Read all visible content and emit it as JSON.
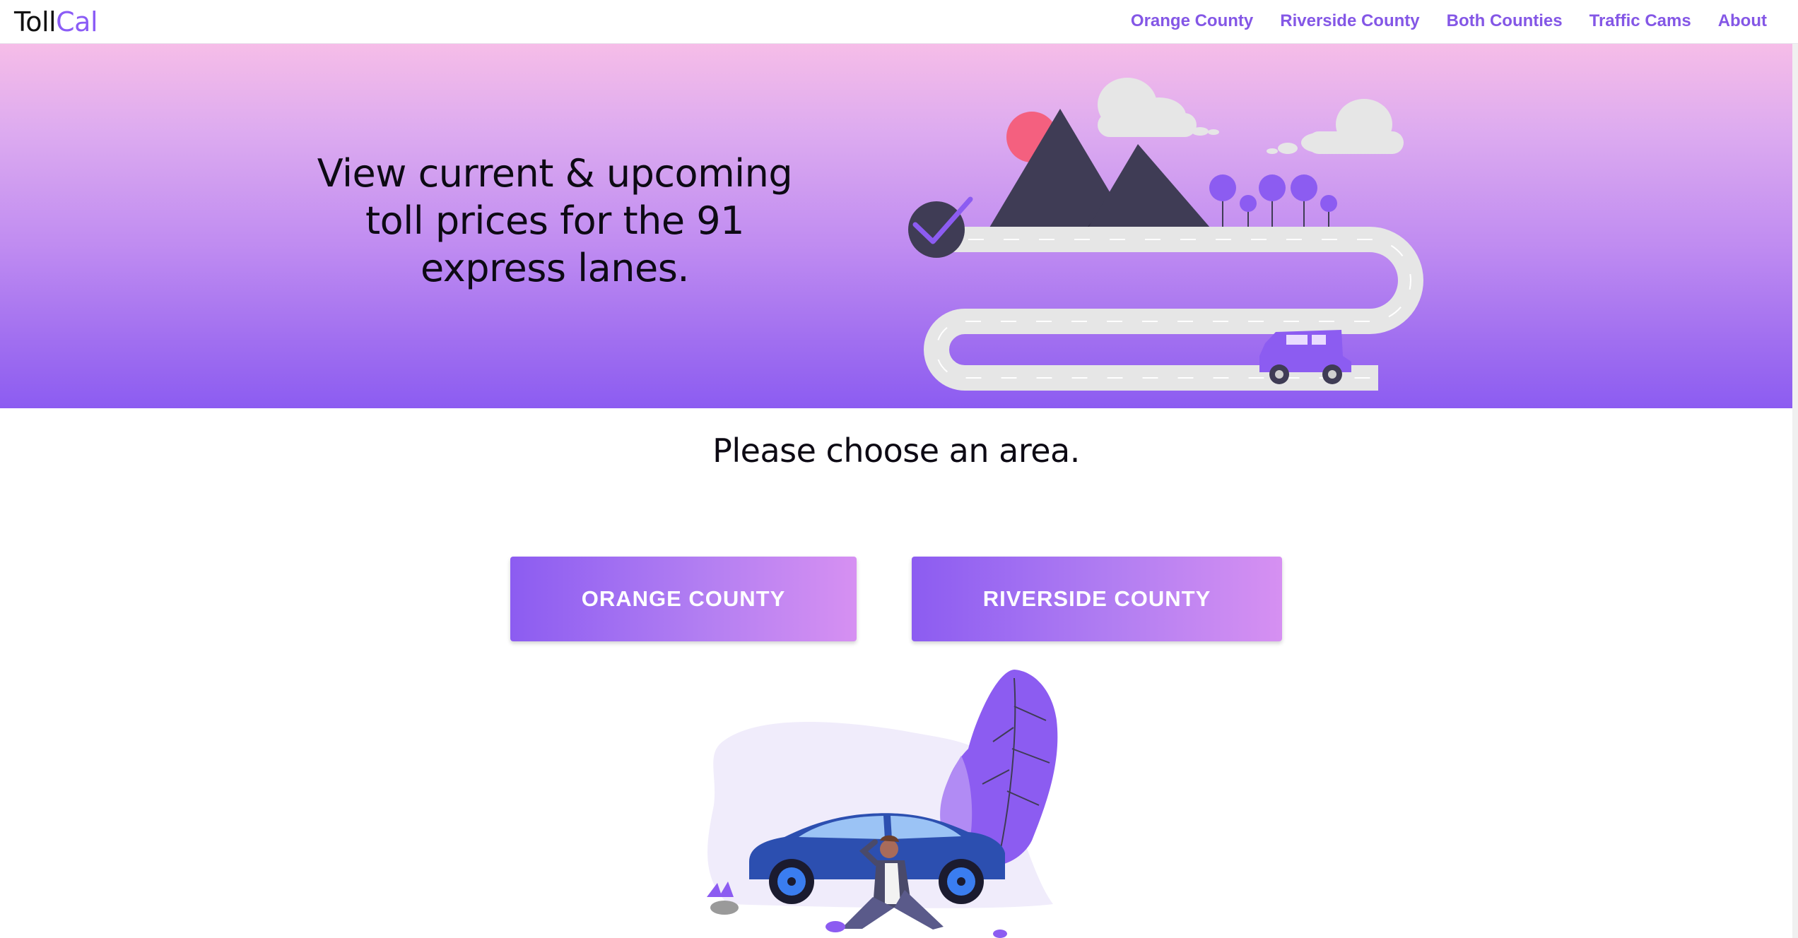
{
  "brand": {
    "part1": "Toll",
    "part2": "Cal"
  },
  "nav": {
    "items": [
      {
        "label": "Orange County"
      },
      {
        "label": "Riverside County"
      },
      {
        "label": "Both Counties"
      },
      {
        "label": "Traffic Cams"
      },
      {
        "label": "About"
      }
    ]
  },
  "hero": {
    "line1": "View current & upcoming",
    "line2": "toll prices for the 91",
    "line3": "express lanes."
  },
  "main": {
    "heading": "Please choose an area.",
    "buttons": [
      {
        "label": "ORANGE COUNTY"
      },
      {
        "label": "RIVERSIDE COUNTY"
      }
    ]
  },
  "colors": {
    "accent": "#8b5cf6",
    "nav_link": "#8457e6",
    "hero_top": "#f6bde8",
    "hero_bottom": "#8c5cf1",
    "button_start": "#8c5cf1",
    "button_end": "#d690f2"
  },
  "icons": {
    "hero_illustration": "road-trip-illustration",
    "checkmark": "check-circle-icon",
    "bottom_illustration": "car-breakdown-illustration"
  }
}
